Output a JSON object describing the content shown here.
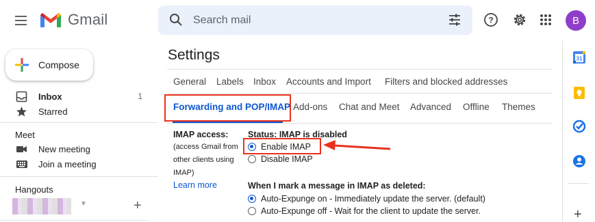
{
  "header": {
    "app_name": "Gmail",
    "search_placeholder": "Search mail",
    "avatar_letter": "B",
    "avatar_color": "#8e3ec8"
  },
  "compose_label": "Compose",
  "nav": {
    "inbox": {
      "label": "Inbox",
      "count": "1",
      "icon": "inbox-icon"
    },
    "starred": {
      "label": "Starred",
      "icon": "star-icon"
    }
  },
  "meet": {
    "title": "Meet",
    "new_meeting": "New meeting",
    "join_meeting": "Join a meeting"
  },
  "hangouts": {
    "title": "Hangouts"
  },
  "settings": {
    "title": "Settings",
    "tabs_row1": [
      "General",
      "Labels",
      "Inbox",
      "Accounts and Import",
      "Filters and blocked addresses"
    ],
    "tabs_row2": [
      "Forwarding and POP/IMAP",
      "Add-ons",
      "Chat and Meet",
      "Advanced",
      "Offline",
      "Themes"
    ],
    "active_tab": "Forwarding and POP/IMAP",
    "imap": {
      "label": "IMAP access:",
      "sub1": "(access Gmail from",
      "sub2": "other clients using",
      "sub3": "IMAP)",
      "learn_more": "Learn more",
      "status": "Status: IMAP is disabled",
      "enable": "Enable IMAP",
      "disable": "Disable IMAP",
      "selected": "enable"
    },
    "delete_section": {
      "heading": "When I mark a message in IMAP as deleted:",
      "option1": "Auto-Expunge on - Immediately update the server. (default)",
      "option2": "Auto-Expunge off - Wait for the client to update the server.",
      "selected": "option1"
    }
  },
  "colors": {
    "accent": "#0b57d0",
    "highlight": "#e8301c"
  }
}
